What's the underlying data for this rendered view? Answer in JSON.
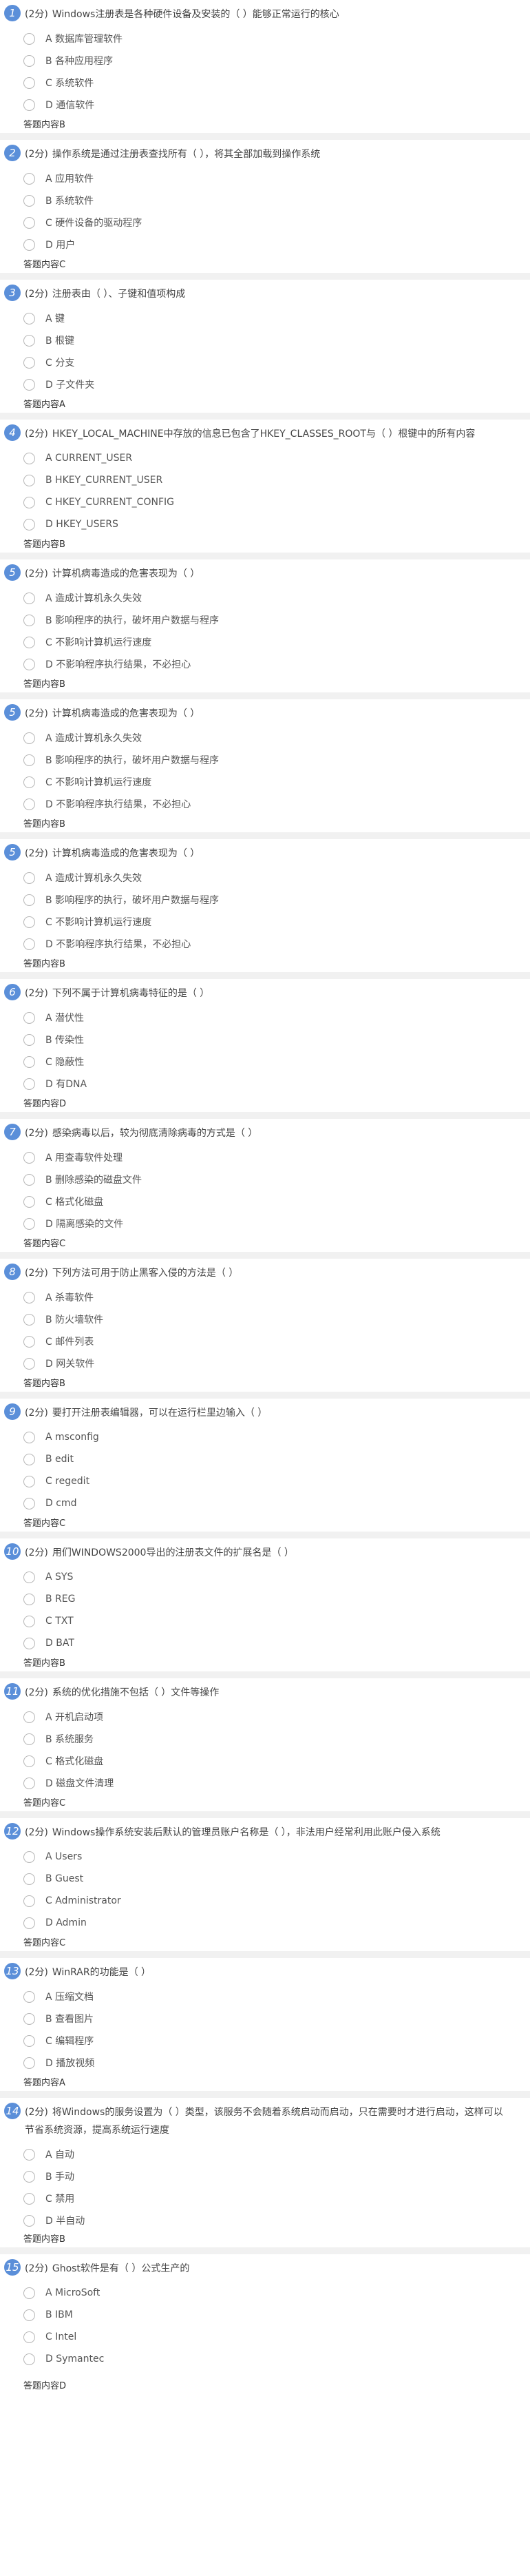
{
  "answer_label": "答题内容",
  "questions": [
    {
      "num": "1",
      "score": "(2分)",
      "text": "Windows注册表是各种硬件设备及安装的（ ）能够正常运行的核心",
      "options": [
        "A 数据库管理软件",
        "B 各种应用程序",
        "C 系统软件",
        "D 通信软件"
      ],
      "answer": "B"
    },
    {
      "num": "2",
      "score": "(2分)",
      "text": "操作系统是通过注册表查找所有（ ），将其全部加载到操作系统",
      "options": [
        "A 应用软件",
        "B 系统软件",
        "C 硬件设备的驱动程序",
        "D 用户"
      ],
      "answer": "C"
    },
    {
      "num": "3",
      "score": "(2分)",
      "text": "注册表由（ ）、子键和值项构成",
      "options": [
        "A 键",
        "B 根键",
        "C 分支",
        "D 子文件夹"
      ],
      "answer": "A"
    },
    {
      "num": "4",
      "score": "(2分)",
      "text": "HKEY_LOCAL_MACHINE中存放的信息已包含了HKEY_CLASSES_ROOT与（ ）根键中的所有内容",
      "options": [
        "A CURRENT_USER",
        "B HKEY_CURRENT_USER",
        "C HKEY_CURRENT_CONFIG",
        "D HKEY_USERS"
      ],
      "answer": "B"
    },
    {
      "num": "5",
      "score": "(2分)",
      "text": "计算机病毒造成的危害表现为（ ）",
      "options": [
        "A 造成计算机永久失效",
        "B 影响程序的执行，破坏用户数据与程序",
        "C 不影响计算机运行速度",
        "D 不影响程序执行结果，不必担心"
      ],
      "answer": "B"
    },
    {
      "num": "5",
      "score": "(2分)",
      "text": "计算机病毒造成的危害表现为（ ）",
      "options": [
        "A 造成计算机永久失效",
        "B 影响程序的执行，破坏用户数据与程序",
        "C 不影响计算机运行速度",
        "D 不影响程序执行结果，不必担心"
      ],
      "answer": "B"
    },
    {
      "num": "5",
      "score": "(2分)",
      "text": "计算机病毒造成的危害表现为（ ）",
      "options": [
        "A 造成计算机永久失效",
        "B 影响程序的执行，破坏用户数据与程序",
        "C 不影响计算机运行速度",
        "D 不影响程序执行结果，不必担心"
      ],
      "answer": "B"
    },
    {
      "num": "6",
      "score": "(2分)",
      "text": "下列不属于计算机病毒特征的是（ ）",
      "options": [
        "A 潜伏性",
        "B 传染性",
        "C 隐蔽性",
        "D 有DNA"
      ],
      "answer": "D"
    },
    {
      "num": "7",
      "score": "(2分)",
      "text": "感染病毒以后，较为彻底清除病毒的方式是（ ）",
      "options": [
        "A 用查毒软件处理",
        "B 删除感染的磁盘文件",
        "C 格式化磁盘",
        "D 隔离感染的文件"
      ],
      "answer": "C"
    },
    {
      "num": "8",
      "score": "(2分)",
      "text": "下列方法可用于防止黑客入侵的方法是（ ）",
      "options": [
        "A 杀毒软件",
        "B 防火墙软件",
        "C 邮件列表",
        "D 网关软件"
      ],
      "answer": "B"
    },
    {
      "num": "9",
      "score": "(2分)",
      "text": "要打开注册表编辑器，可以在运行栏里边输入（ ）",
      "options": [
        "A msconfig",
        "B edit",
        "C regedit",
        "D cmd"
      ],
      "answer": "C"
    },
    {
      "num": "10",
      "score": "(2分)",
      "text": "用们WINDOWS2000导出的注册表文件的扩展名是（ ）",
      "options": [
        "A SYS",
        "B REG",
        "C TXT",
        "D BAT"
      ],
      "answer": "B"
    },
    {
      "num": "11",
      "score": "(2分)",
      "text": "系统的优化措施不包括（ ）文件等操作",
      "options": [
        "A 开机启动项",
        "B 系统服务",
        "C 格式化磁盘",
        "D 磁盘文件清理"
      ],
      "answer": "C"
    },
    {
      "num": "12",
      "score": "(2分)",
      "text": "Windows操作系统安装后默认的管理员账户名称是（ ），非法用户经常利用此账户侵入系统",
      "options": [
        "A Users",
        "B Guest",
        "C Administrator",
        "D Admin"
      ],
      "answer": "C"
    },
    {
      "num": "13",
      "score": "(2分)",
      "text": "WinRAR的功能是（ ）",
      "options": [
        "A 压缩文档",
        "B 查看图片",
        "C 编辑程序",
        "D 播放视频"
      ],
      "answer": "A"
    },
    {
      "num": "14",
      "score": "(2分)",
      "text": "将Windows的服务设置为（ ）类型，该服务不会随着系统启动而启动，只在需要时才进行启动，这样可以节省系统资源，提高系统运行速度",
      "options": [
        "A 自动",
        "B 手动",
        "C 禁用",
        "D 半自动"
      ],
      "answer": "B"
    },
    {
      "num": "15",
      "score": "(2分)",
      "text": "Ghost软件是有（ ）公式生产的",
      "options": [
        "A MicroSoft",
        "B IBM",
        "C Intel",
        "D Symantec"
      ],
      "answer": "D"
    }
  ]
}
